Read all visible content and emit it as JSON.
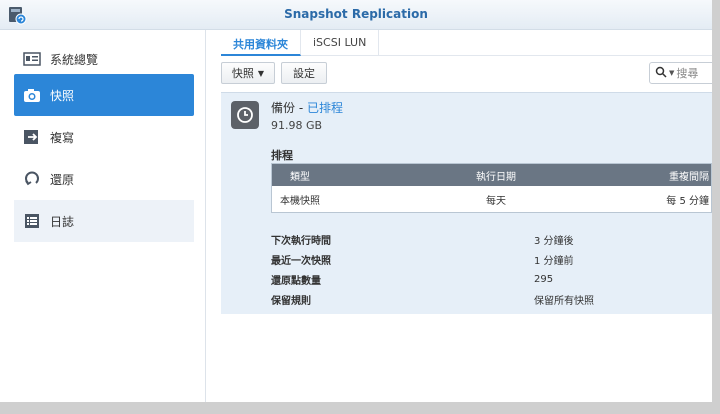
{
  "window": {
    "title": "Snapshot Replication"
  },
  "sidebar": {
    "items": [
      {
        "label": "系統總覽",
        "icon": "overview-icon"
      },
      {
        "label": "快照",
        "icon": "camera-icon",
        "active": true
      },
      {
        "label": "複寫",
        "icon": "replication-icon"
      },
      {
        "label": "還原",
        "icon": "restore-icon"
      },
      {
        "label": "日誌",
        "icon": "log-icon"
      }
    ]
  },
  "tabs": [
    {
      "label": "共用資料夾",
      "active": true
    },
    {
      "label": "iSCSI LUN"
    }
  ],
  "toolbar": {
    "snapshot_label": "快照",
    "settings_label": "設定",
    "search_placeholder": "搜尋"
  },
  "share": {
    "name": "備份",
    "separator": " - ",
    "status": "已排程",
    "size": "91.98 GB"
  },
  "schedule": {
    "section_label": "排程",
    "columns": [
      "類型",
      "執行日期",
      "重複間隔"
    ],
    "rows": [
      {
        "type": "本機快照",
        "date": "每天",
        "interval": "每 5 分鐘"
      }
    ]
  },
  "details": [
    {
      "key": "下次執行時間",
      "value": "3 分鐘後"
    },
    {
      "key": "最近一次快照",
      "value": "1 分鐘前"
    },
    {
      "key": "還原點數量",
      "value": "295"
    },
    {
      "key": "保留規則",
      "value": "保留所有快照"
    }
  ],
  "colors": {
    "accent": "#2c86d8",
    "panel": "#e6eff8",
    "table_header": "#6a7684"
  }
}
